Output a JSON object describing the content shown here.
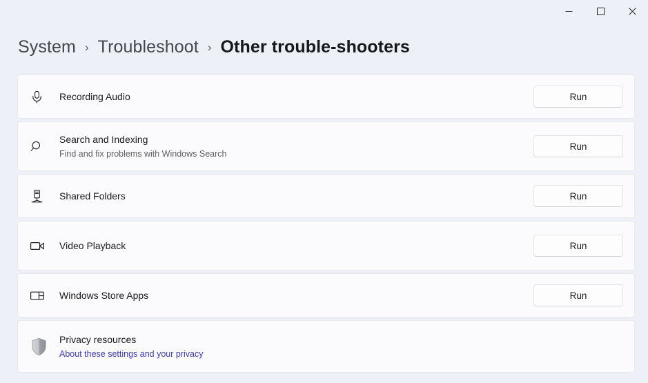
{
  "window": {
    "controls": [
      {
        "name": "minimize",
        "label": "Minimize"
      },
      {
        "name": "maximize",
        "label": "Maximize"
      },
      {
        "name": "close",
        "label": "Close"
      }
    ]
  },
  "breadcrumb": {
    "items": [
      {
        "label": "System",
        "current": false
      },
      {
        "label": "Troubleshoot",
        "current": false
      },
      {
        "label": "Other trouble-shooters",
        "current": true
      }
    ],
    "separator": "›"
  },
  "colors": {
    "page_background": "#eef0f8",
    "card_background": "#fbfbfd",
    "card_border": "#e8e9ee",
    "text_primary": "#1a1a1c",
    "text_secondary": "#5d5f63",
    "link": "#3b3bb0",
    "breadcrumb_parent": "#45474d",
    "breadcrumb_current": "#17181c"
  },
  "troubleshooters": [
    {
      "icon": "microphone-icon",
      "title": "Recording Audio",
      "subtitle": "",
      "action": "Run"
    },
    {
      "icon": "search-icon",
      "title": "Search and Indexing",
      "subtitle": "Find and fix problems with Windows Search",
      "action": "Run"
    },
    {
      "icon": "server-icon",
      "title": "Shared Folders",
      "subtitle": "",
      "action": "Run"
    },
    {
      "icon": "video-camera-icon",
      "title": "Video Playback",
      "subtitle": "",
      "action": "Run"
    },
    {
      "icon": "app-panels-icon",
      "title": "Windows Store Apps",
      "subtitle": "",
      "action": "Run"
    }
  ],
  "privacy": {
    "icon": "shield-icon",
    "title": "Privacy resources",
    "link_label": "About these settings and your privacy"
  }
}
